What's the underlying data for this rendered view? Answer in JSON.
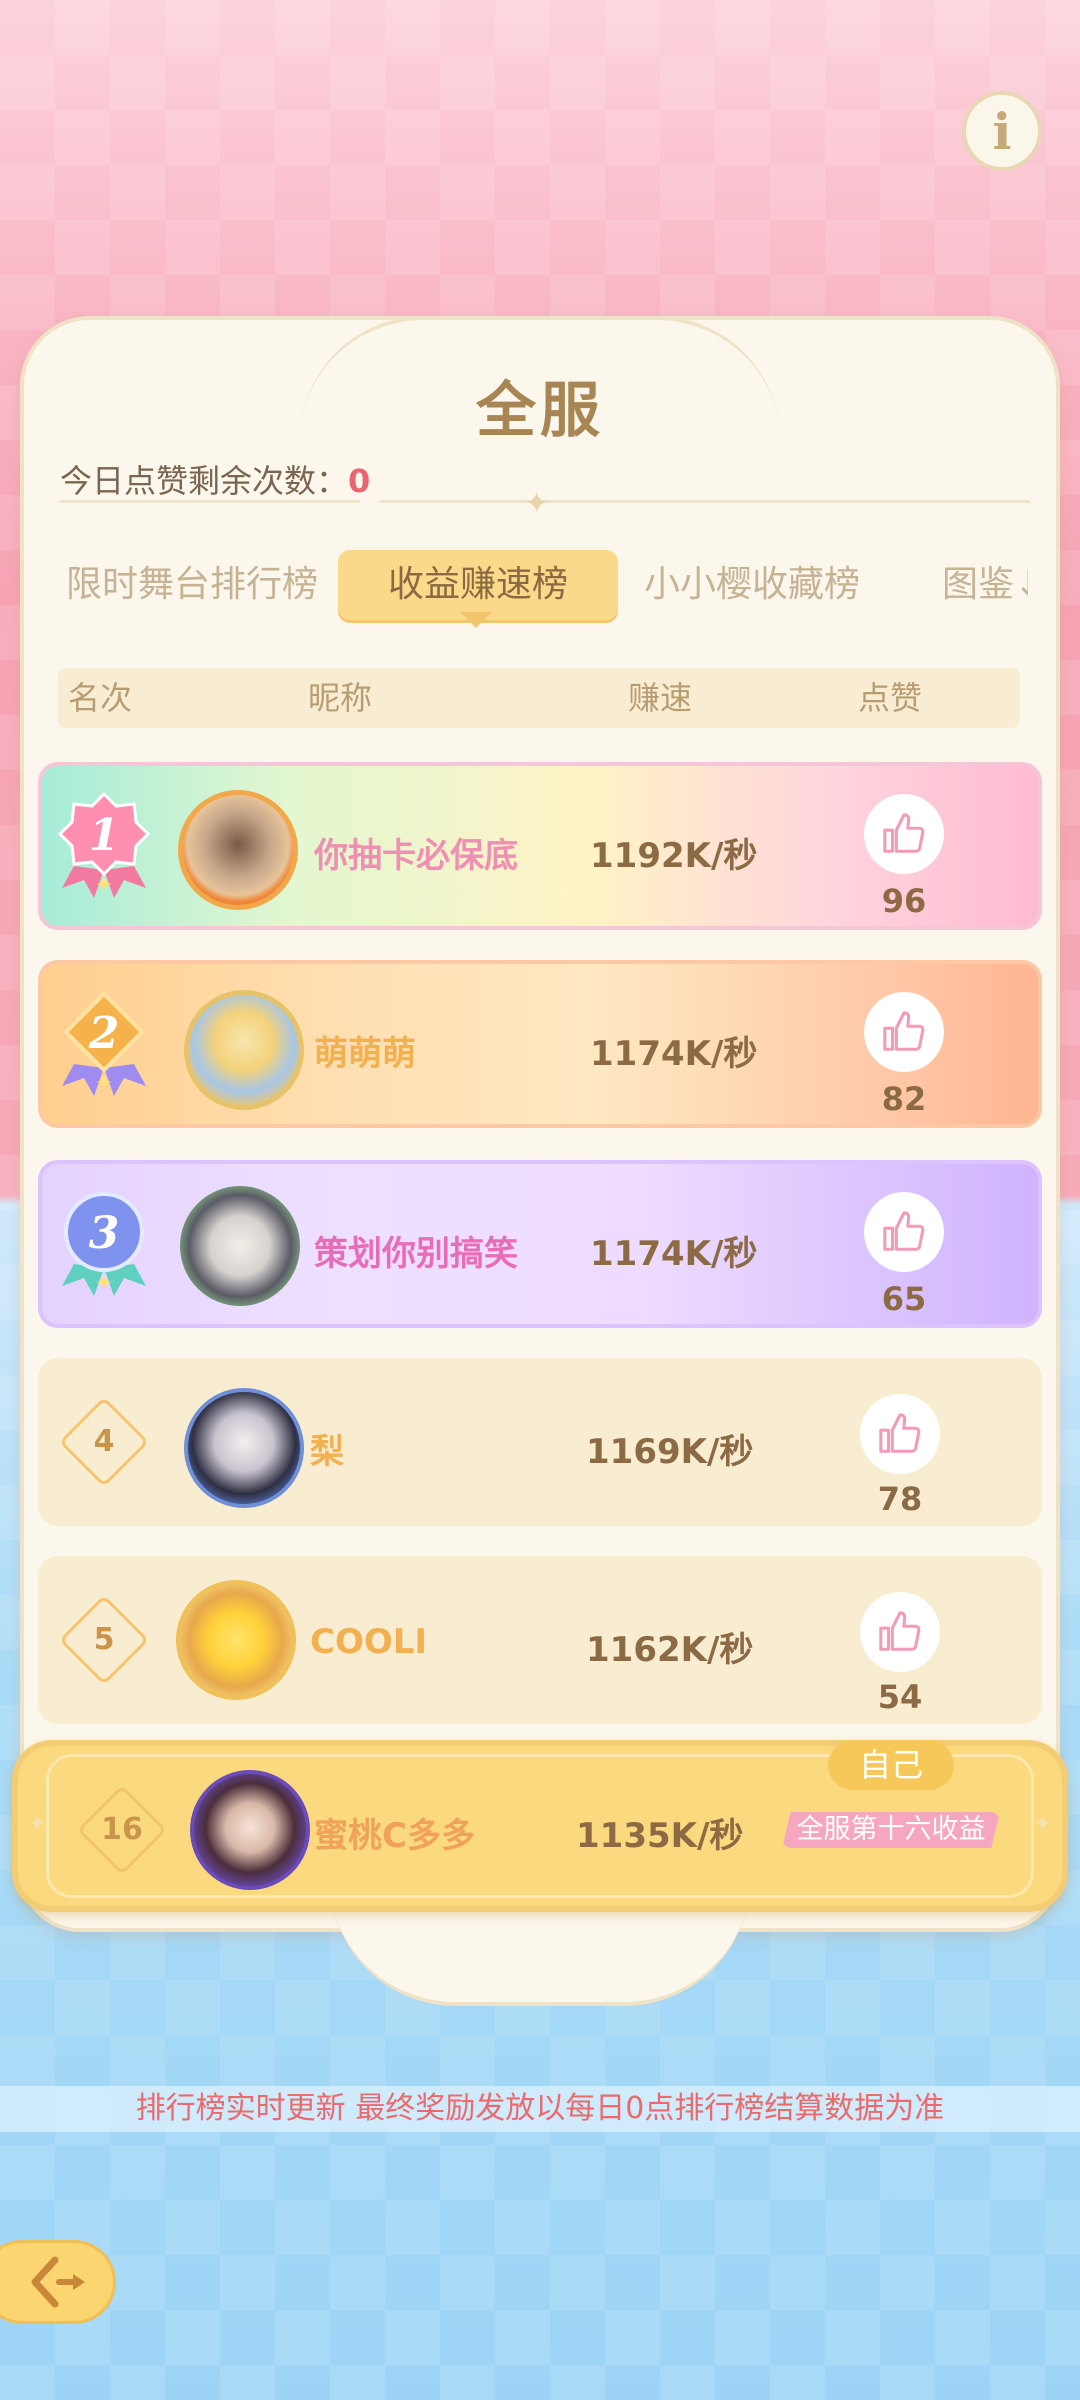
{
  "header": {
    "title": "全服",
    "likes_label": "今日点赞剩余次数：",
    "likes_value": "0"
  },
  "tabs": [
    {
      "label": "限时舞台排行榜"
    },
    {
      "label": "收益赚速榜",
      "active": true
    },
    {
      "label": "小小樱收藏榜"
    },
    {
      "label": "图鉴↓"
    }
  ],
  "columns": {
    "rank": "名次",
    "nickname": "昵称",
    "speed": "赚速",
    "like": "点赞"
  },
  "rows": [
    {
      "rank": "1",
      "nickname": "你抽卡必保底",
      "speed": "1192K/秒",
      "likes": "96"
    },
    {
      "rank": "2",
      "nickname": "萌萌萌",
      "speed": "1174K/秒",
      "likes": "82"
    },
    {
      "rank": "3",
      "nickname": "策划你别搞笑",
      "speed": "1174K/秒",
      "likes": "65"
    },
    {
      "rank": "4",
      "nickname": "梨",
      "speed": "1169K/秒",
      "likes": "78"
    },
    {
      "rank": "5",
      "nickname": "COOLI",
      "speed": "1162K/秒",
      "likes": "54"
    }
  ],
  "self": {
    "rank": "16",
    "nickname": "蜜桃C多多",
    "speed": "1135K/秒",
    "tag": "自己",
    "desc": "全服第十六收益"
  },
  "notice": "排行榜实时更新 最终奖励发放以每日0点排行榜结算数据为准",
  "colors": {
    "nick_rank1": "#ef8fb4",
    "nick_rank2": "#f2b04f",
    "nick_rank3": "#e86db8",
    "nick_default": "#f2b04f",
    "accent": "#fbd98a"
  },
  "icons": {
    "info": "info-icon",
    "like": "thumbs-up-icon",
    "back": "back-arrow-icon"
  }
}
